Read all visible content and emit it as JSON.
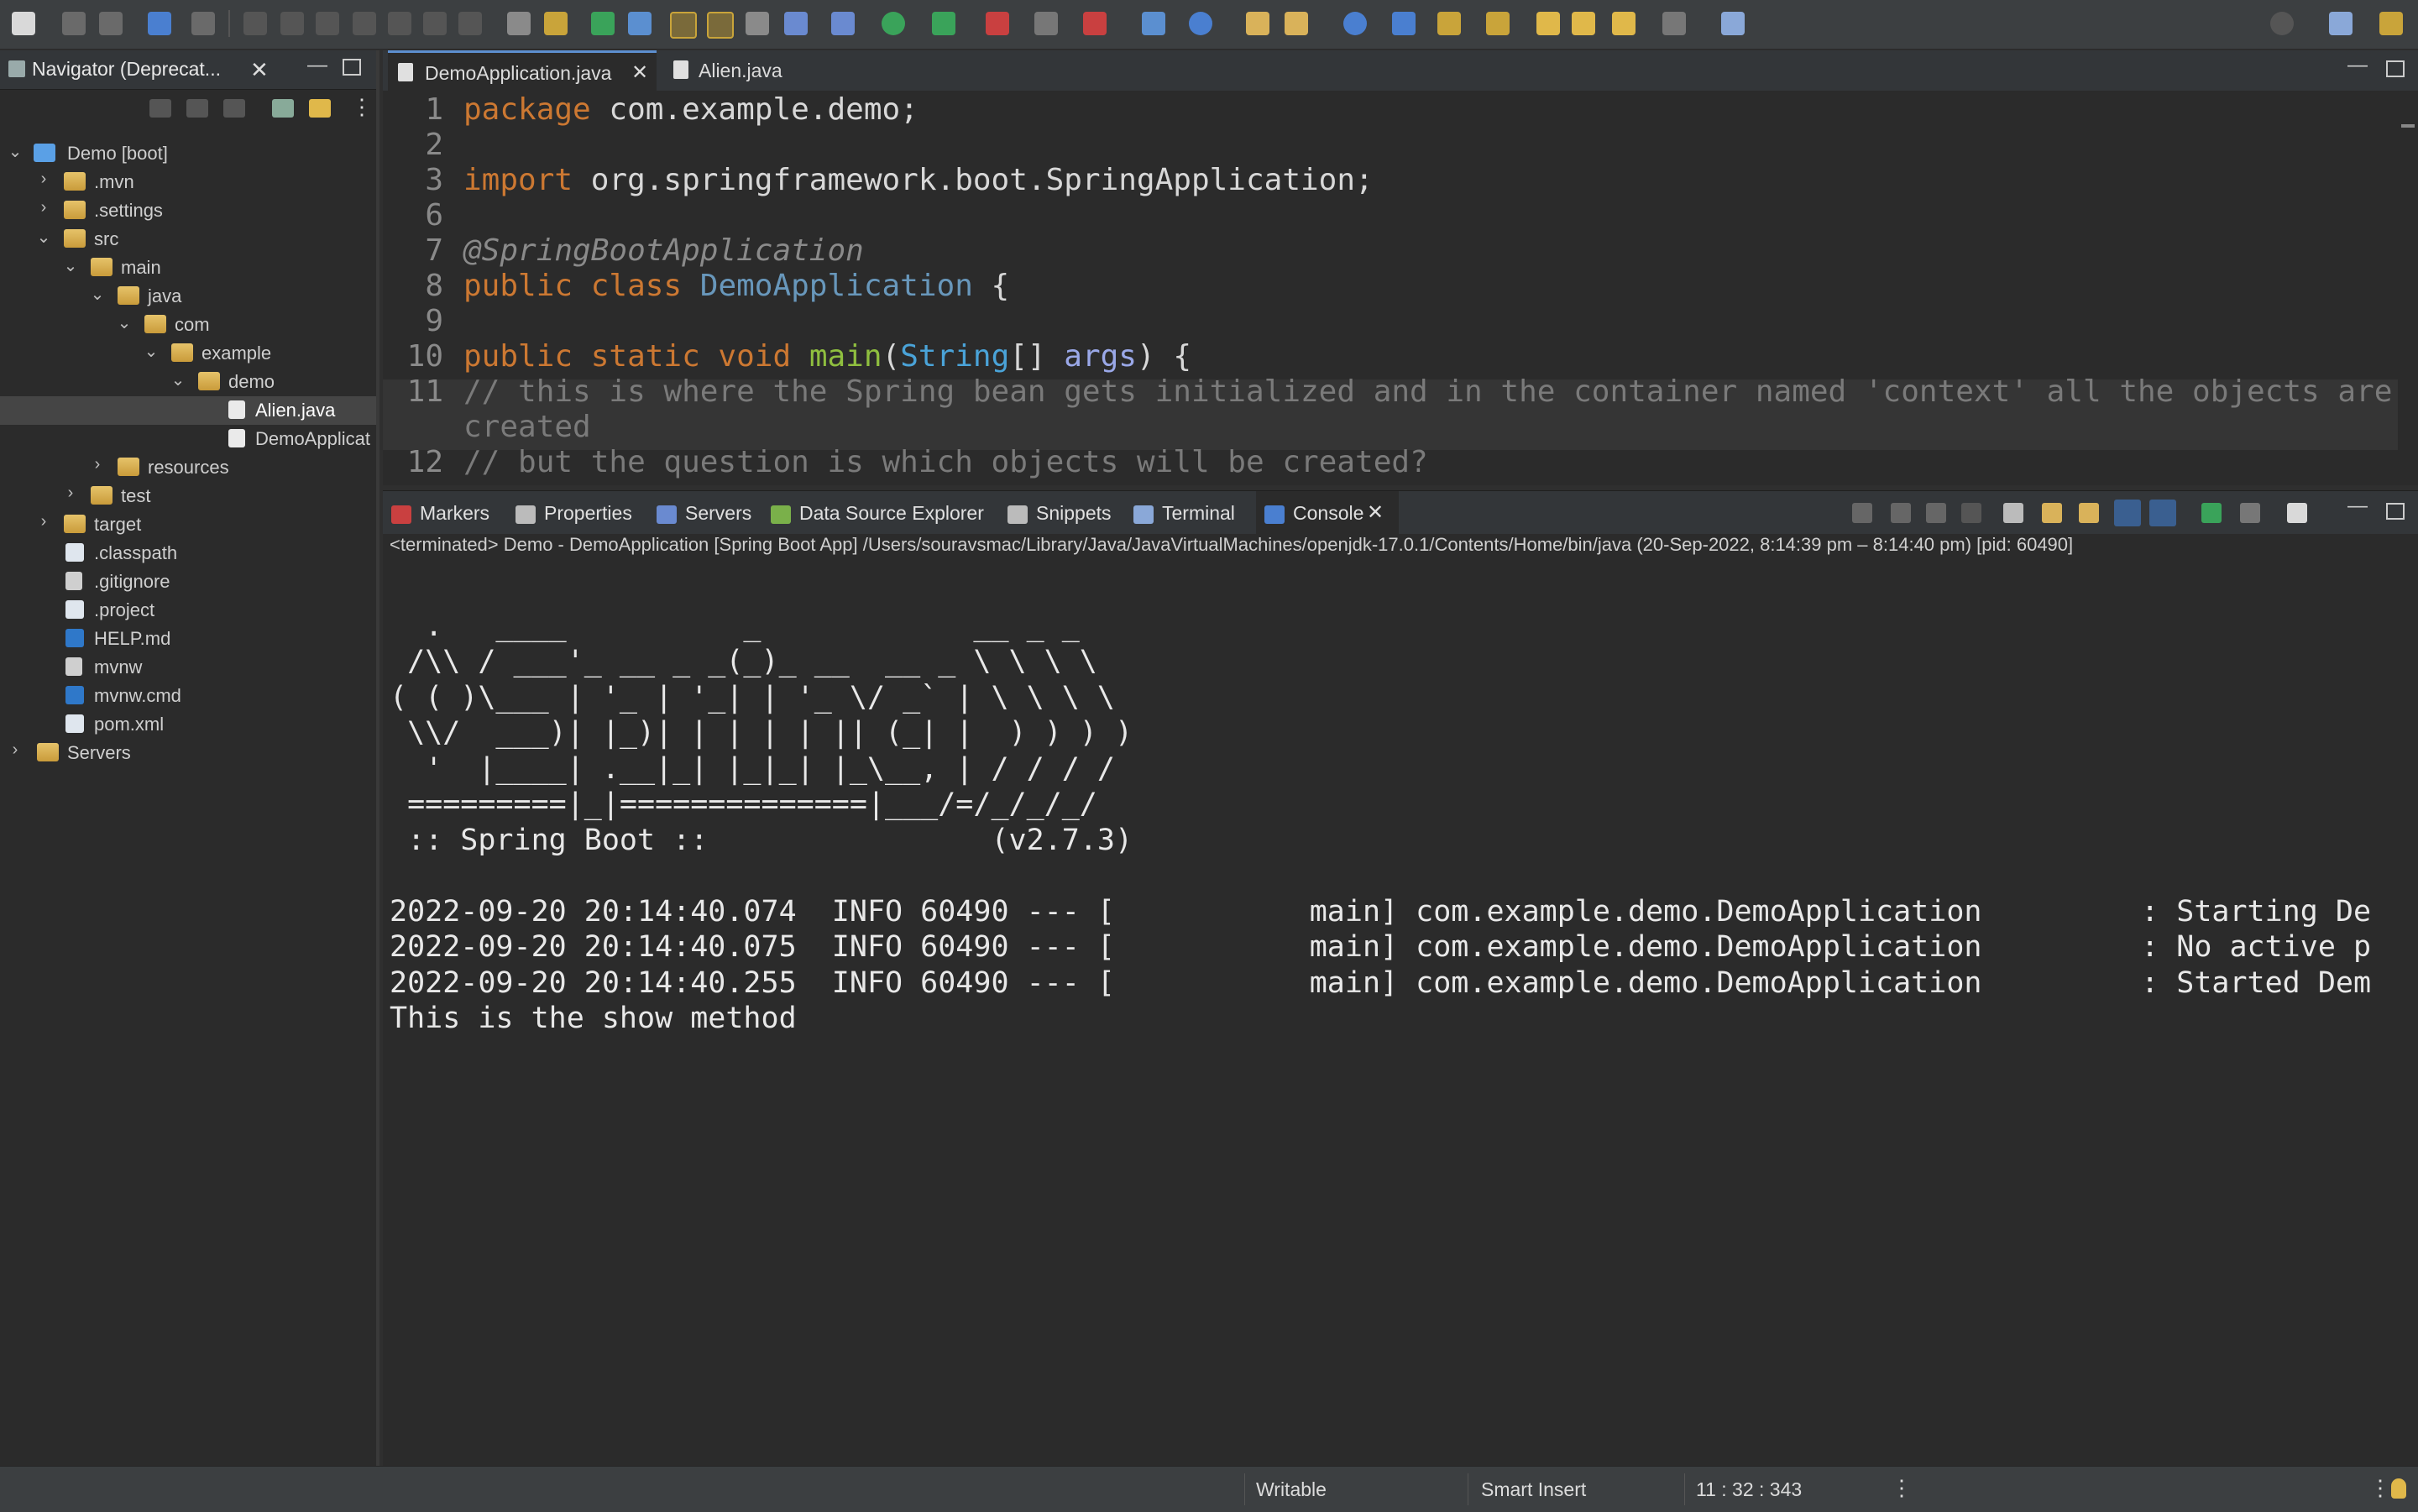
{
  "navigator": {
    "title": "Navigator (Deprecat...",
    "tree": [
      {
        "label": "Demo [boot]",
        "expanded": true,
        "icon": "project-icon"
      },
      {
        "label": ".mvn",
        "expanded": false,
        "icon": "folder-icon"
      },
      {
        "label": ".settings",
        "expanded": false,
        "icon": "folder-icon"
      },
      {
        "label": "src",
        "expanded": true,
        "icon": "folder-icon"
      },
      {
        "label": "main",
        "expanded": true,
        "icon": "folder-icon"
      },
      {
        "label": "java",
        "expanded": true,
        "icon": "folder-icon"
      },
      {
        "label": "com",
        "expanded": true,
        "icon": "folder-icon"
      },
      {
        "label": "example",
        "expanded": true,
        "icon": "folder-icon"
      },
      {
        "label": "demo",
        "expanded": true,
        "icon": "folder-icon"
      },
      {
        "label": "Alien.java",
        "selected": true,
        "icon": "java-file-icon"
      },
      {
        "label": "DemoApplicat",
        "icon": "java-file-icon"
      },
      {
        "label": "resources",
        "expanded": false,
        "icon": "folder-icon"
      },
      {
        "label": "test",
        "expanded": false,
        "icon": "folder-icon"
      },
      {
        "label": "target",
        "expanded": false,
        "icon": "folder-icon"
      },
      {
        "label": ".classpath",
        "icon": "xml-file-icon"
      },
      {
        "label": ".gitignore",
        "icon": "text-file-icon"
      },
      {
        "label": ".project",
        "icon": "xml-file-icon"
      },
      {
        "label": "HELP.md",
        "icon": "markdown-file-icon"
      },
      {
        "label": "mvnw",
        "icon": "text-file-icon"
      },
      {
        "label": "mvnw.cmd",
        "icon": "markdown-file-icon"
      },
      {
        "label": "pom.xml",
        "icon": "maven-file-icon"
      },
      {
        "label": "Servers",
        "expanded": false,
        "icon": "folder-icon"
      }
    ]
  },
  "editor": {
    "tabs": [
      {
        "label": "DemoApplication.java",
        "active": true
      },
      {
        "label": "Alien.java",
        "active": false
      }
    ],
    "lines": [
      {
        "n": "1",
        "parts": [
          [
            "kw",
            "package "
          ],
          [
            "txt",
            "com.example.demo;"
          ]
        ]
      },
      {
        "n": "2",
        "parts": []
      },
      {
        "n": "3",
        "parts": [
          [
            "kw",
            "import "
          ],
          [
            "txt",
            "org.springframework.boot.SpringApplication;"
          ]
        ]
      },
      {
        "n": "6",
        "parts": []
      },
      {
        "n": "7",
        "parts": [
          [
            "ann",
            "@SpringBootApplication"
          ]
        ]
      },
      {
        "n": "8",
        "parts": [
          [
            "kw",
            "public class "
          ],
          [
            "cls",
            "DemoApplication"
          ],
          [
            "txt",
            " {"
          ]
        ]
      },
      {
        "n": "9",
        "parts": []
      },
      {
        "n": "10",
        "parts": [
          [
            "kw",
            "public static void "
          ],
          [
            "fn",
            "main"
          ],
          [
            "txt",
            "("
          ],
          [
            "type",
            "String"
          ],
          [
            "txt",
            "[] "
          ],
          [
            "var",
            "args"
          ],
          [
            "txt",
            ") {"
          ]
        ]
      },
      {
        "n": "11",
        "parts": [
          [
            "cmt",
            "// this is where the Spring bean gets initialized and in the container named 'context' all the objects are"
          ]
        ]
      },
      {
        "n": "",
        "parts": [
          [
            "cmt",
            "created"
          ]
        ]
      },
      {
        "n": "12",
        "parts": [
          [
            "cmt",
            "// but the question is which objects will be created?"
          ]
        ]
      }
    ]
  },
  "console": {
    "tabs": [
      {
        "label": "Markers",
        "icon": "markers-icon"
      },
      {
        "label": "Properties",
        "icon": "properties-icon"
      },
      {
        "label": "Servers",
        "icon": "servers-icon"
      },
      {
        "label": "Data Source Explorer",
        "icon": "data-source-icon"
      },
      {
        "label": "Snippets",
        "icon": "snippets-icon"
      },
      {
        "label": "Terminal",
        "icon": "terminal-icon"
      },
      {
        "label": "Console",
        "icon": "console-icon",
        "active": true
      }
    ],
    "status": "<terminated> Demo - DemoApplication [Spring Boot App] /Users/souravsmac/Library/Java/JavaVirtualMachines/openjdk-17.0.1/Contents/Home/bin/java  (20-Sep-2022, 8:14:39 pm – 8:14:40 pm) [pid: 60490]",
    "output": "\n  .   ____          _            __ _ _\n /\\\\ / ___'_ __ _ _(_)_ __  __ _ \\ \\ \\ \\\n( ( )\\___ | '_ | '_| | '_ \\/ _` | \\ \\ \\ \\\n \\\\/  ___)| |_)| | | | | || (_| |  ) ) ) )\n  '  |____| .__|_| |_|_| |_\\__, | / / / /\n =========|_|==============|___/=/_/_/_/\n :: Spring Boot ::                (v2.7.3)\n\n2022-09-20 20:14:40.074  INFO 60490 --- [           main] com.example.demo.DemoApplication         : Starting De\n2022-09-20 20:14:40.075  INFO 60490 --- [           main] com.example.demo.DemoApplication         : No active p\n2022-09-20 20:14:40.255  INFO 60490 --- [           main] com.example.demo.DemoApplication         : Started Dem\nThis is the show method"
  },
  "statusbar": {
    "writable": "Writable",
    "insert_mode": "Smart Insert",
    "position": "11 : 32 : 343"
  }
}
